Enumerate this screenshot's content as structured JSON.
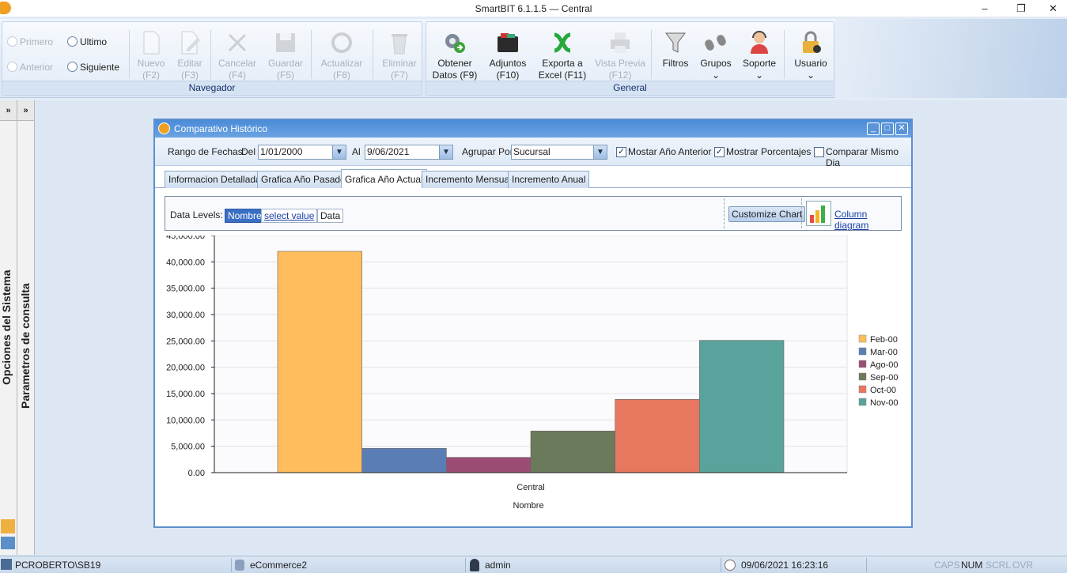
{
  "window": {
    "title": "SmartBIT 6.1.1.5 — Central",
    "minimize": "–",
    "maximize": "❐",
    "close": "✕"
  },
  "ribbon": {
    "navegador": {
      "label": "Navegador",
      "primero": "Primero",
      "anterior": "Anterior",
      "ultimo": "Ultimo",
      "siguiente": "Siguiente",
      "nuevo": [
        "Nuevo",
        "(F2)"
      ],
      "editar": [
        "Editar",
        "(F3)"
      ],
      "cancelar": [
        "Cancelar",
        "(F4)"
      ],
      "guardar": [
        "Guardar",
        "(F5)"
      ],
      "actualizar": [
        "Actualizar",
        "(F8)"
      ],
      "eliminar": [
        "Eliminar",
        "(F7)"
      ]
    },
    "general": {
      "label": "General",
      "obtener": [
        "Obtener",
        "Datos (F9)"
      ],
      "adjuntos": [
        "Adjuntos",
        "(F10)"
      ],
      "exporta": [
        "Exporta a",
        "Excel (F11)"
      ],
      "vista": [
        "Vista Previa",
        "(F12)"
      ],
      "filtros": "Filtros",
      "grupos": "Grupos",
      "soporte": "Soporte",
      "usuario": "Usuario"
    }
  },
  "sidebar": {
    "opciones": "Opciones del Sistema",
    "parametros": "Parametros de consulta",
    "expand": "»"
  },
  "child_window": {
    "title": "Comparativo Histórico",
    "filters": {
      "rango_label": "Rango de Fechas:",
      "del_label": "Del",
      "del_value": "1/01/2000",
      "al_label": "Al",
      "al_value": "9/06/2021",
      "agrupar_label": "Agrupar Por",
      "agrupar_value": "Sucursal",
      "mostrar_anio": "Mostar Año Anterior",
      "mostrar_anio_checked": true,
      "mostrar_porc": "Mostrar Porcentajes",
      "mostrar_porc_checked": true,
      "comparar": "Comparar Mismo Dia",
      "comparar_checked": false
    },
    "tabs": [
      "Informacion Detallada",
      "Grafica Año Pasado",
      "Grafica Año Actual",
      "Incremento Mensual",
      "Incremento Anual"
    ],
    "active_tab": 2,
    "data_levels": {
      "label": "Data Levels:",
      "nombre": "Nombre",
      "select_value": "select value",
      "data": "Data",
      "customize": "Customize Chart",
      "column_diagram": "Column diagram"
    }
  },
  "chart_data": {
    "type": "bar",
    "categories": [
      "Central"
    ],
    "xlabel": "Nombre",
    "ylim": [
      0,
      45000
    ],
    "yticks": [
      "0.00",
      "5,000.00",
      "10,000.00",
      "15,000.00",
      "20,000.00",
      "25,000.00",
      "30,000.00",
      "35,000.00",
      "40,000.00",
      "45,000.00"
    ],
    "series": [
      {
        "name": "Feb-00",
        "values": [
          42000
        ],
        "color": "#ffbd5e"
      },
      {
        "name": "Mar-00",
        "values": [
          4600
        ],
        "color": "#5b7db5"
      },
      {
        "name": "Ago-00",
        "values": [
          2900
        ],
        "color": "#9b4d73"
      },
      {
        "name": "Sep-00",
        "values": [
          7900
        ],
        "color": "#6b7a5a"
      },
      {
        "name": "Oct-00",
        "values": [
          13900
        ],
        "color": "#e8775f"
      },
      {
        "name": "Nov-00",
        "values": [
          25100
        ],
        "color": "#5aa39c"
      }
    ],
    "legend_position": "right",
    "grid": true
  },
  "statusbar": {
    "machine": "PCROBERTO\\SB19",
    "db": "eCommerce2",
    "user": "admin",
    "datetime": "09/06/2021 16:23:16",
    "caps": "CAPS",
    "num": "NUM",
    "scrl": "SCRL",
    "ovr": "OVR"
  }
}
